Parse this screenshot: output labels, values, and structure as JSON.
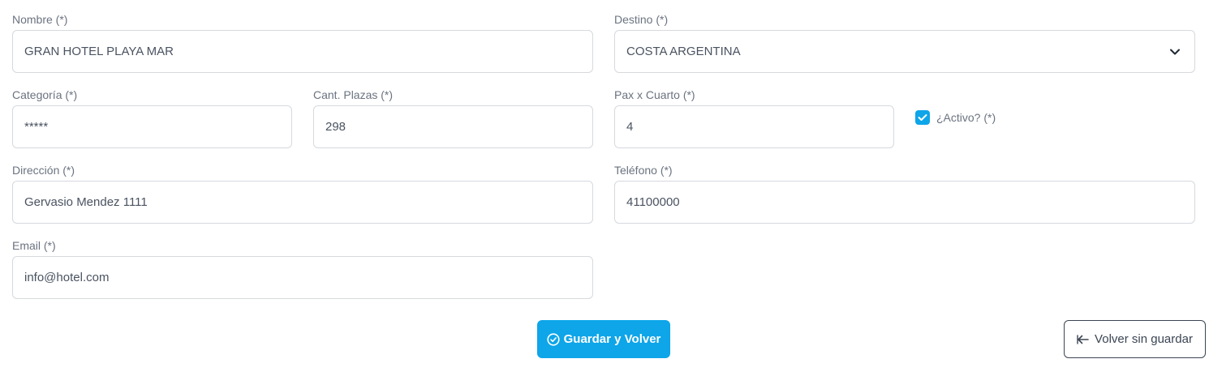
{
  "form": {
    "nombre": {
      "label": "Nombre (*)",
      "value": "GRAN HOTEL PLAYA MAR"
    },
    "destino": {
      "label": "Destino (*)",
      "value": "COSTA ARGENTINA"
    },
    "categoria": {
      "label": "Categoría (*)",
      "value": "*****"
    },
    "cant_plazas": {
      "label": "Cant. Plazas (*)",
      "value": "298"
    },
    "pax_x_cuarto": {
      "label": "Pax x Cuarto (*)",
      "value": "4"
    },
    "activo": {
      "label": "¿Activo? (*)",
      "checked": true
    },
    "direccion": {
      "label": "Dirección (*)",
      "value": "Gervasio Mendez 1111"
    },
    "telefono": {
      "label": "Teléfono (*)",
      "value": "41100000"
    },
    "email": {
      "label": "Email (*)",
      "value": "info@hotel.com"
    }
  },
  "actions": {
    "save_label": "Guardar y Volver",
    "back_label": "Volver sin guardar"
  },
  "icons": {
    "select": "chevron-down-icon",
    "checkbox": "check-icon",
    "save": "check-circle-icon",
    "back": "arrow-left-icon"
  },
  "colors": {
    "accent": "#0ea5e9",
    "text": "#3b4554",
    "label": "#6b7380",
    "border": "#d6d9de"
  }
}
